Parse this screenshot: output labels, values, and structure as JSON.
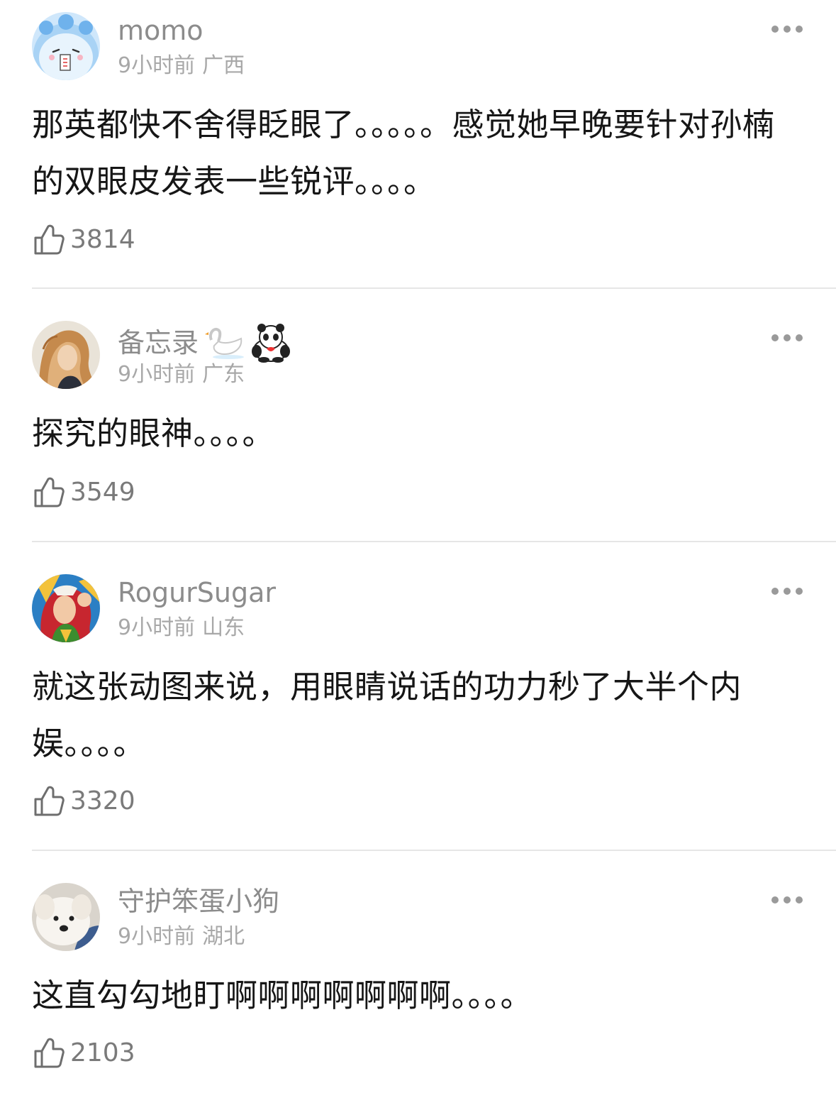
{
  "comments": [
    {
      "username": "momo",
      "time": "9小时前",
      "region": "广西",
      "text": "那英都快不舍得眨眼了。。。。。感觉她早晚要针对孙楠的双眼皮发表一些锐评。。。。",
      "likes": "3814",
      "avatar_icon": "blue-blob-avatar"
    },
    {
      "username": "备忘录",
      "badges": [
        "swan-icon",
        "panda-icon"
      ],
      "time": "9小时前",
      "region": "广东",
      "text": "探究的眼神。。。。",
      "likes": "3549",
      "avatar_icon": "painted-portrait-avatar"
    },
    {
      "username": "RogurSugar",
      "time": "9小时前",
      "region": "山东",
      "text": "就这张动图来说，用眼睛说话的功力秒了大半个内娱。。。。",
      "likes": "3320",
      "avatar_icon": "comic-heroine-avatar"
    },
    {
      "username": "守护笨蛋小狗",
      "time": "9小时前",
      "region": "湖北",
      "text": "这直勾勾地盯啊啊啊啊啊啊啊。。。。",
      "likes": "2103",
      "avatar_icon": "white-puppy-avatar"
    }
  ],
  "icons": {
    "more": "more-dots-icon",
    "like": "thumbs-up-icon"
  },
  "colors": {
    "username": "#8c8c8c",
    "meta": "#a8a8a8",
    "text": "#161616",
    "like_count": "#7a7a7a",
    "divider": "#e6e6e6"
  }
}
